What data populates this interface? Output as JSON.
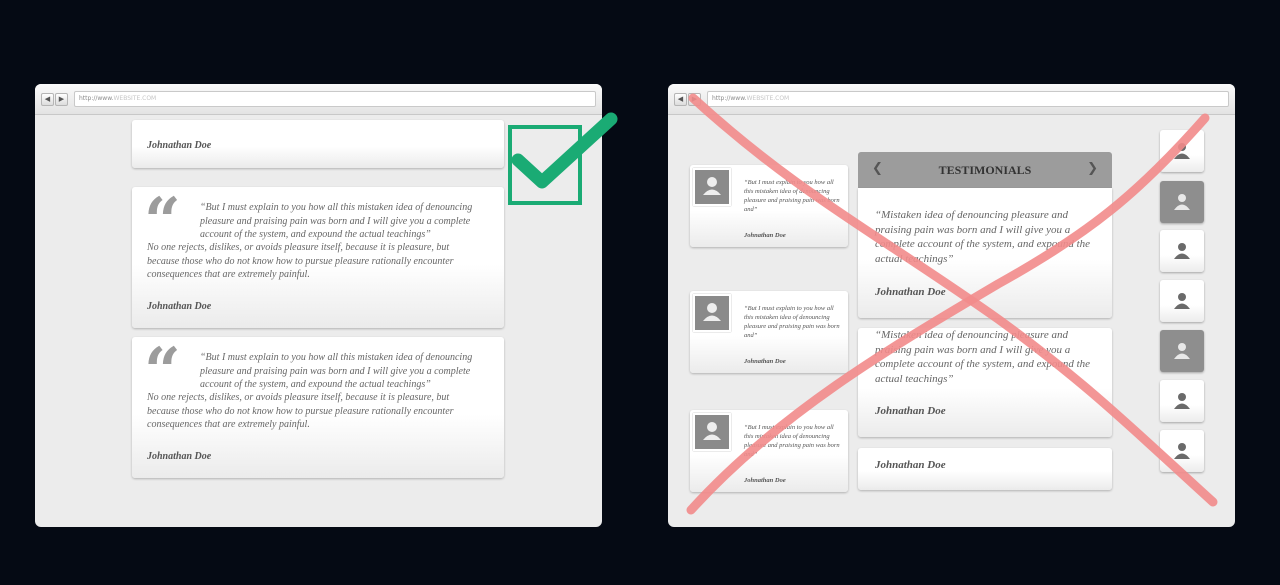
{
  "left_browser": {
    "address": {
      "prefix": "http://www.",
      "domain": "WEBSITE.COM"
    },
    "top_card": {
      "author": "Johnathan Doe"
    },
    "cards": [
      {
        "lead": "“But I must explain to you how all this mistaken idea of denouncing pleasure and praising pain was born and I will give you a complete account of the system, and expound the actual teachings”",
        "rest": "No one rejects, dislikes, or avoids pleasure itself, because it is pleasure, but because those who do not know how to pursue pleasure rationally encounter consequences that are extremely painful.",
        "author": "Johnathan Doe"
      },
      {
        "lead": "“But I must explain to you how all this mistaken idea of denouncing pleasure and praising pain was born and I will give you a complete account of the system, and expound the actual teachings”",
        "rest": "No one rejects, dislikes, or avoids pleasure itself, because it is pleasure, but because those who do not know how to pursue pleasure rationally encounter consequences that are extremely painful.",
        "author": "Johnathan Doe"
      }
    ],
    "check_color": "#1aab74"
  },
  "right_browser": {
    "address": {
      "prefix": "http://www.",
      "domain": "WEBSITE.COM"
    },
    "small_cards": [
      {
        "lead": "“But I must explain to you how all this mistaken idea of denouncing pleasure and praising pain was born and”",
        "author": "Johnathan Doe"
      },
      {
        "lead": "“But I must explain to you how all this mistaken idea of denouncing pleasure and praising pain was born and”",
        "author": "Johnathan Doe"
      },
      {
        "lead": "“But I must explain to you how all this mistaken idea of denouncing pleasure and praising pain was born and”",
        "author": "Johnathan Doe"
      }
    ],
    "panel": {
      "title": "TESTIMONIALS",
      "prev_icon": "chevron-left-icon",
      "next_icon": "chevron-right-icon"
    },
    "testimonials": [
      {
        "lead": "“Mistaken idea of denouncing pleasure and praising pain was born and I will give you a complete account of the system, and expound the actual teachings”",
        "author": "Johnathan Doe"
      },
      {
        "lead": "“Mistaken idea of denouncing pleasure and praising pain was born and I will give you a complete account of the system, and expound the actual teachings”",
        "author": "Johnathan Doe"
      },
      {
        "author": "Johnathan Doe"
      }
    ],
    "avatar_column": {
      "count": 7,
      "active_indices": [
        1,
        4
      ]
    },
    "cross_color": "#f28b8b"
  }
}
